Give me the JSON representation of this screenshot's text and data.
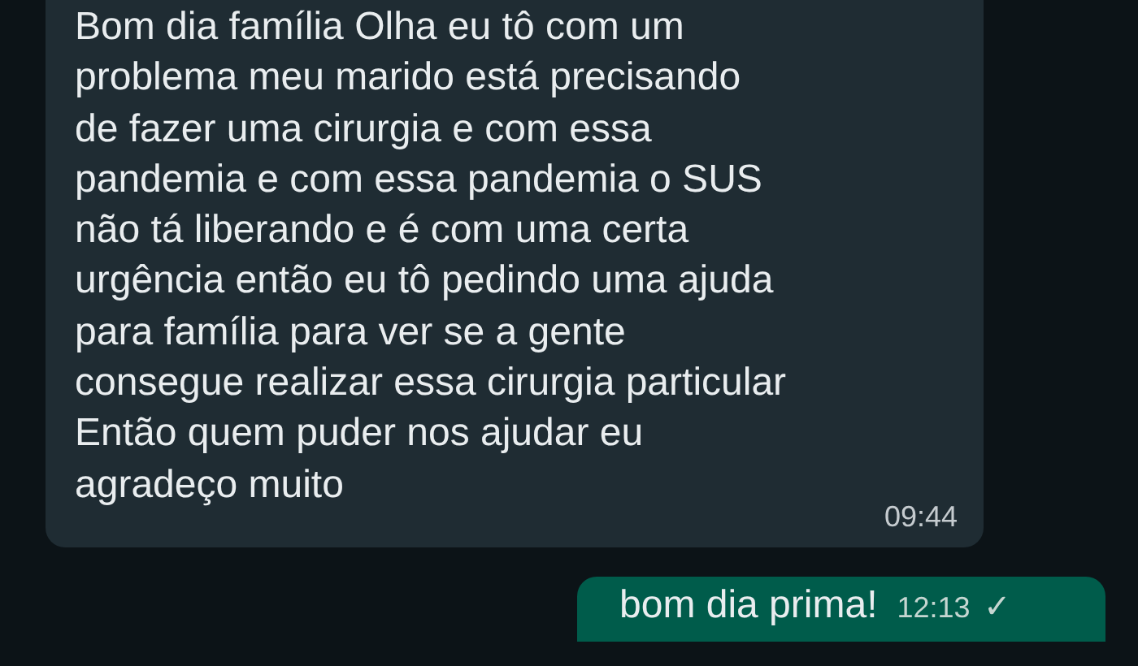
{
  "messages": [
    {
      "kind": "incoming",
      "text": "Bom dia família Olha eu tô com um\nproblema meu marido está precisando\nde fazer uma cirurgia e com essa\npandemia e com essa pandemia o SUS\nnão tá liberando e é com uma certa\nurgência então eu tô pedindo uma ajuda\npara família para ver se a gente\nconsegue realizar essa cirurgia particular\nEntão quem puder nos ajudar eu\nagradeço muito",
      "time": "09:44"
    },
    {
      "kind": "outgoing",
      "text": "bom dia prima!",
      "time": "12:13",
      "tick": "✓"
    }
  ]
}
